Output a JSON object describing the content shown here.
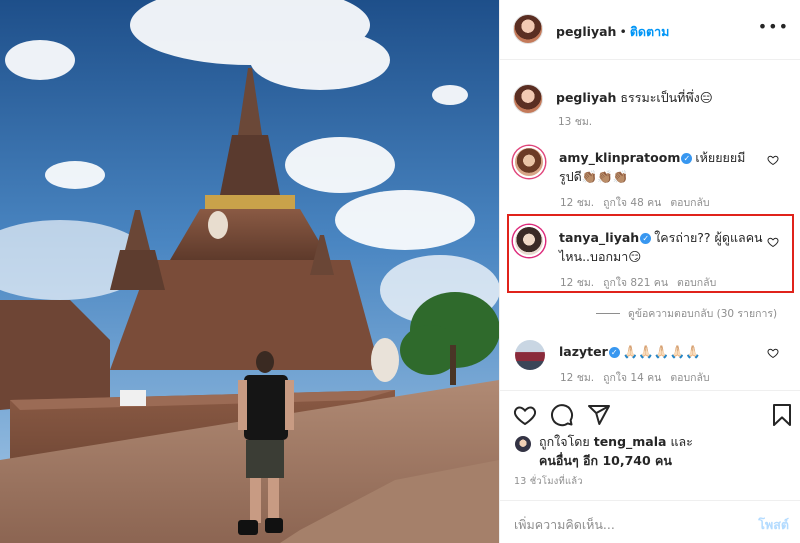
{
  "post": {
    "author": "pegliyah",
    "follow_label": "ติดตาม",
    "separator": "•",
    "caption_text": "ธรรมะเป็นที่พึ่ง😑",
    "caption_time": "13 ชม."
  },
  "comments": [
    {
      "username": "amy_klinpratoom",
      "verified": true,
      "text": "เห้ยยยยมีรูปดี👏🏽👏🏽👏🏽",
      "time": "12 ชม.",
      "likes": "ถูกใจ 48 คน",
      "reply": "ตอบกลับ"
    },
    {
      "username": "tanya_liyah",
      "verified": true,
      "text_line1": "ใครถ่าย?? ผู้ดูแลคน",
      "text_line2": "ไหน..บอกมา😏",
      "time": "12 ชม.",
      "likes": "ถูกใจ 821 คน",
      "reply": "ตอบกลับ"
    },
    {
      "username": "lazyter",
      "verified": true,
      "text": "🙏🏻🙏🏻🙏🏻🙏🏻🙏🏻",
      "time": "12 ชม.",
      "likes": "ถูกใจ 14 คน",
      "reply": "ตอบกลับ"
    }
  ],
  "view_replies": "ดูข้อความตอบกลับ (30 รายการ)",
  "likes_summary": {
    "prefix": "ถูกใจโดย",
    "user": "teng_mala",
    "and": "และ",
    "others_line": "คนอื่นๆ อีก 10,740 คน"
  },
  "time_ago": "13 ชั่วโมงที่แล้ว",
  "add_comment_placeholder": "เพิ่มความคิดเห็น...",
  "post_button": "โพสต์",
  "icons": {
    "header_more": "more-horizontal-icon",
    "like": "heart-icon",
    "comment": "comment-icon",
    "share": "paper-plane-icon",
    "save": "bookmark-icon",
    "comment_like": "heart-outline-icon"
  },
  "colors": {
    "accent_blue": "#0095f6",
    "highlight_red": "#e0231b",
    "muted_text": "#8e8e8e",
    "verified_blue": "#3897f0"
  }
}
